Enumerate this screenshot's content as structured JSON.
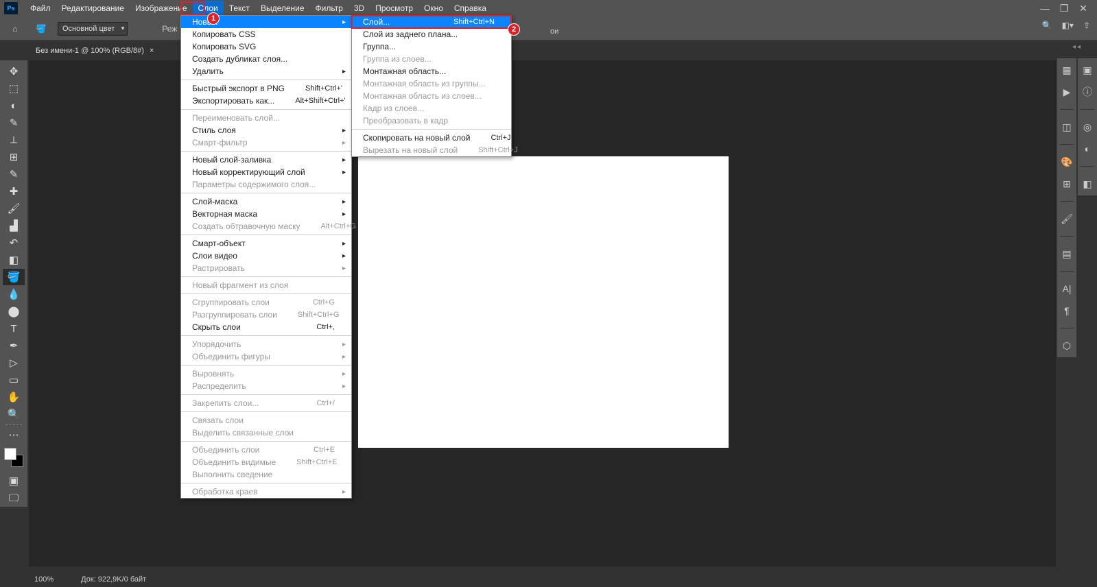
{
  "window": {
    "title": "Ps"
  },
  "menubar": [
    "Файл",
    "Редактирование",
    "Изображение",
    "Слои",
    "Текст",
    "Выделение",
    "Фильтр",
    "3D",
    "Просмотр",
    "Окно",
    "Справка"
  ],
  "menubar_active_index": 3,
  "options_bar": {
    "fill_mode": "Основной цвет",
    "partial_label": "Реж"
  },
  "doc_tab": {
    "label": "Без имени-1 @ 100% (RGB/8#)"
  },
  "statusbar": {
    "zoom": "100%",
    "doc": "Док: 922,9K/0 байт"
  },
  "menu1": [
    {
      "label": "Новый",
      "sub": true,
      "highlight": true
    },
    {
      "label": "Копировать CSS"
    },
    {
      "label": "Копировать SVG"
    },
    {
      "label": "Создать дубликат слоя..."
    },
    {
      "label": "Удалить",
      "sub": true
    },
    {
      "sep": true
    },
    {
      "label": "Быстрый экспорт в PNG",
      "shortcut": "Shift+Ctrl+'"
    },
    {
      "label": "Экспортировать как...",
      "shortcut": "Alt+Shift+Ctrl+'"
    },
    {
      "sep": true
    },
    {
      "label": "Переименовать слой...",
      "disabled": true
    },
    {
      "label": "Стиль слоя",
      "sub": true
    },
    {
      "label": "Смарт-фильтр",
      "sub": true,
      "disabled": true
    },
    {
      "sep": true
    },
    {
      "label": "Новый слой-заливка",
      "sub": true
    },
    {
      "label": "Новый корректирующий слой",
      "sub": true
    },
    {
      "label": "Параметры содержимого слоя...",
      "disabled": true
    },
    {
      "sep": true
    },
    {
      "label": "Слой-маска",
      "sub": true
    },
    {
      "label": "Векторная маска",
      "sub": true
    },
    {
      "label": "Создать обтравочную маску",
      "shortcut": "Alt+Ctrl+G",
      "disabled": true
    },
    {
      "sep": true
    },
    {
      "label": "Смарт-объект",
      "sub": true
    },
    {
      "label": "Слои видео",
      "sub": true
    },
    {
      "label": "Растрировать",
      "sub": true,
      "disabled": true
    },
    {
      "sep": true
    },
    {
      "label": "Новый фрагмент из слоя",
      "disabled": true
    },
    {
      "sep": true
    },
    {
      "label": "Сгруппировать слои",
      "shortcut": "Ctrl+G",
      "disabled": true
    },
    {
      "label": "Разгруппировать слои",
      "shortcut": "Shift+Ctrl+G",
      "disabled": true
    },
    {
      "label": "Скрыть слои",
      "shortcut": "Ctrl+,"
    },
    {
      "sep": true
    },
    {
      "label": "Упорядочить",
      "sub": true,
      "disabled": true
    },
    {
      "label": "Объединить фигуры",
      "sub": true,
      "disabled": true
    },
    {
      "sep": true
    },
    {
      "label": "Выровнять",
      "sub": true,
      "disabled": true
    },
    {
      "label": "Распределить",
      "sub": true,
      "disabled": true
    },
    {
      "sep": true
    },
    {
      "label": "Закрепить слои...",
      "shortcut": "Ctrl+/",
      "disabled": true
    },
    {
      "sep": true
    },
    {
      "label": "Связать слои",
      "disabled": true
    },
    {
      "label": "Выделить связанные слои",
      "disabled": true
    },
    {
      "sep": true
    },
    {
      "label": "Объединить слои",
      "shortcut": "Ctrl+E",
      "disabled": true
    },
    {
      "label": "Объединить видимые",
      "shortcut": "Shift+Ctrl+E",
      "disabled": true
    },
    {
      "label": "Выполнить сведение",
      "disabled": true
    },
    {
      "sep": true
    },
    {
      "label": "Обработка краев",
      "sub": true,
      "disabled": true
    }
  ],
  "menu2": [
    {
      "label": "Слой...",
      "shortcut": "Shift+Ctrl+N",
      "highlight": true
    },
    {
      "label": "Слой из заднего плана..."
    },
    {
      "label": "Группа..."
    },
    {
      "label": "Группа из слоев...",
      "disabled": true
    },
    {
      "label": "Монтажная область..."
    },
    {
      "label": "Монтажная область из группы...",
      "disabled": true
    },
    {
      "label": "Монтажная область из слоев...",
      "disabled": true
    },
    {
      "label": "Кадр из слоев...",
      "disabled": true
    },
    {
      "label": "Преобразовать в кадр",
      "disabled": true
    },
    {
      "sep": true
    },
    {
      "label": "Скопировать на новый слой",
      "shortcut": "Ctrl+J"
    },
    {
      "label": "Вырезать на новый слой",
      "shortcut": "Shift+Ctrl+J",
      "disabled": true
    }
  ],
  "callouts": {
    "one": "1",
    "two": "2"
  },
  "right_options_text": "ои"
}
